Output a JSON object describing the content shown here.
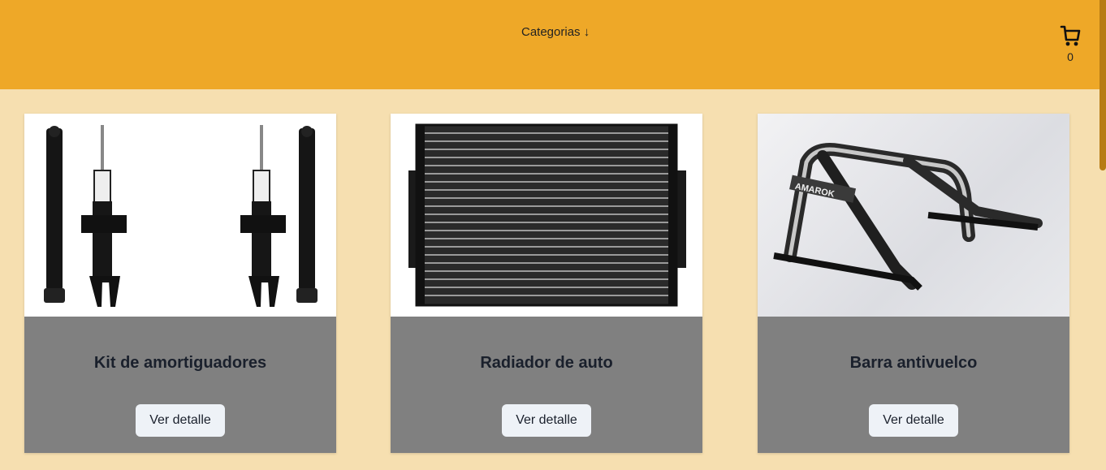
{
  "header": {
    "categories_label": "Categorias ↓",
    "cart_icon": "cart-icon",
    "cart_count": "0",
    "bg_color": "#eea828"
  },
  "products": [
    {
      "title": "Kit de amortiguadores",
      "button_label": "Ver detalle",
      "image": "shock-absorbers-image"
    },
    {
      "title": "Radiador de auto",
      "button_label": "Ver detalle",
      "image": "radiator-image"
    },
    {
      "title": "Barra antivuelco",
      "button_label": "Ver detalle",
      "image": "roll-bar-image",
      "image_text": "AMAROK"
    }
  ]
}
